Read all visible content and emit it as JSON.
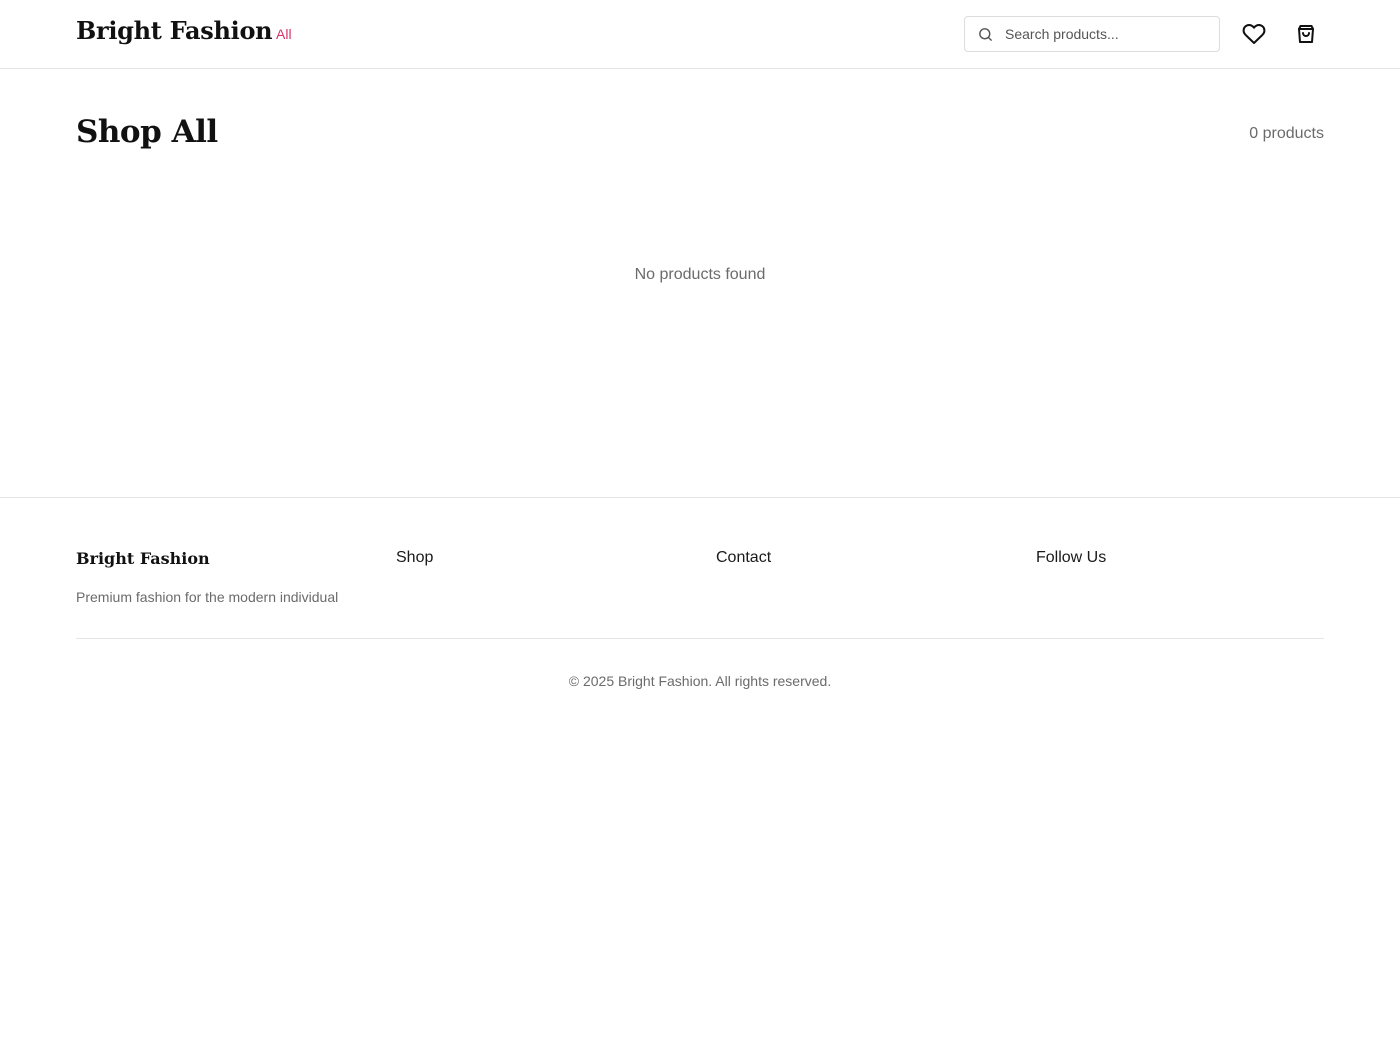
{
  "header": {
    "logo": "Bright Fashion",
    "nav": [
      {
        "label": "All"
      }
    ],
    "search": {
      "placeholder": "Search products...",
      "value": ""
    },
    "icons": {
      "search": "search-icon",
      "wishlist": "heart-icon",
      "cart": "shopping-bag-icon"
    }
  },
  "main": {
    "title": "Shop All",
    "product_count": "0 products",
    "empty_message": "No products found"
  },
  "footer": {
    "brand": "Bright Fashion",
    "tagline": "Premium fashion for the modern individual",
    "columns": [
      {
        "heading": "Shop"
      },
      {
        "heading": "Contact"
      },
      {
        "heading": "Follow Us"
      }
    ],
    "copyright": "© 2025 Bright Fashion. All rights reserved."
  },
  "colors": {
    "accent": "#d6336c",
    "text": "#1a1a1a",
    "muted": "#6b6b6b",
    "border": "#e5e5e5"
  }
}
